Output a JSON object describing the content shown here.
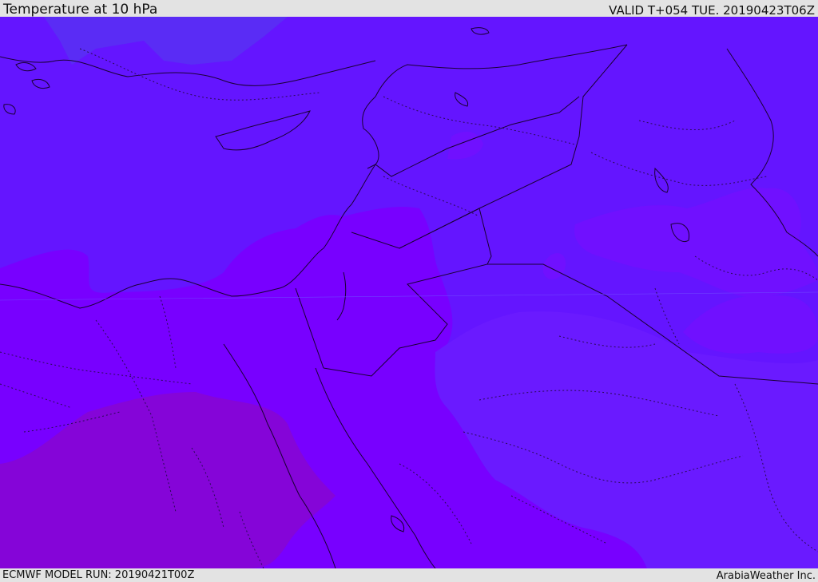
{
  "header": {
    "title": "Temperature at 10 hPa",
    "valid_time": "VALID T+054 TUE. 20190423T06Z"
  },
  "footer": {
    "model_run": "ECMWF MODEL RUN: 20190421T00Z",
    "credit": "ArabiaWeather Inc."
  },
  "map": {
    "region": "Eastern Mediterranean / Middle East",
    "parameter": "temperature",
    "level_hpa": 10,
    "fill_colors": {
      "cool": "#6415ff",
      "cooler": "#5a28f5",
      "mid": "#7800ff",
      "warm": "#8000ff",
      "warmest": "#8505d8"
    },
    "border_color": "#1a0033"
  }
}
